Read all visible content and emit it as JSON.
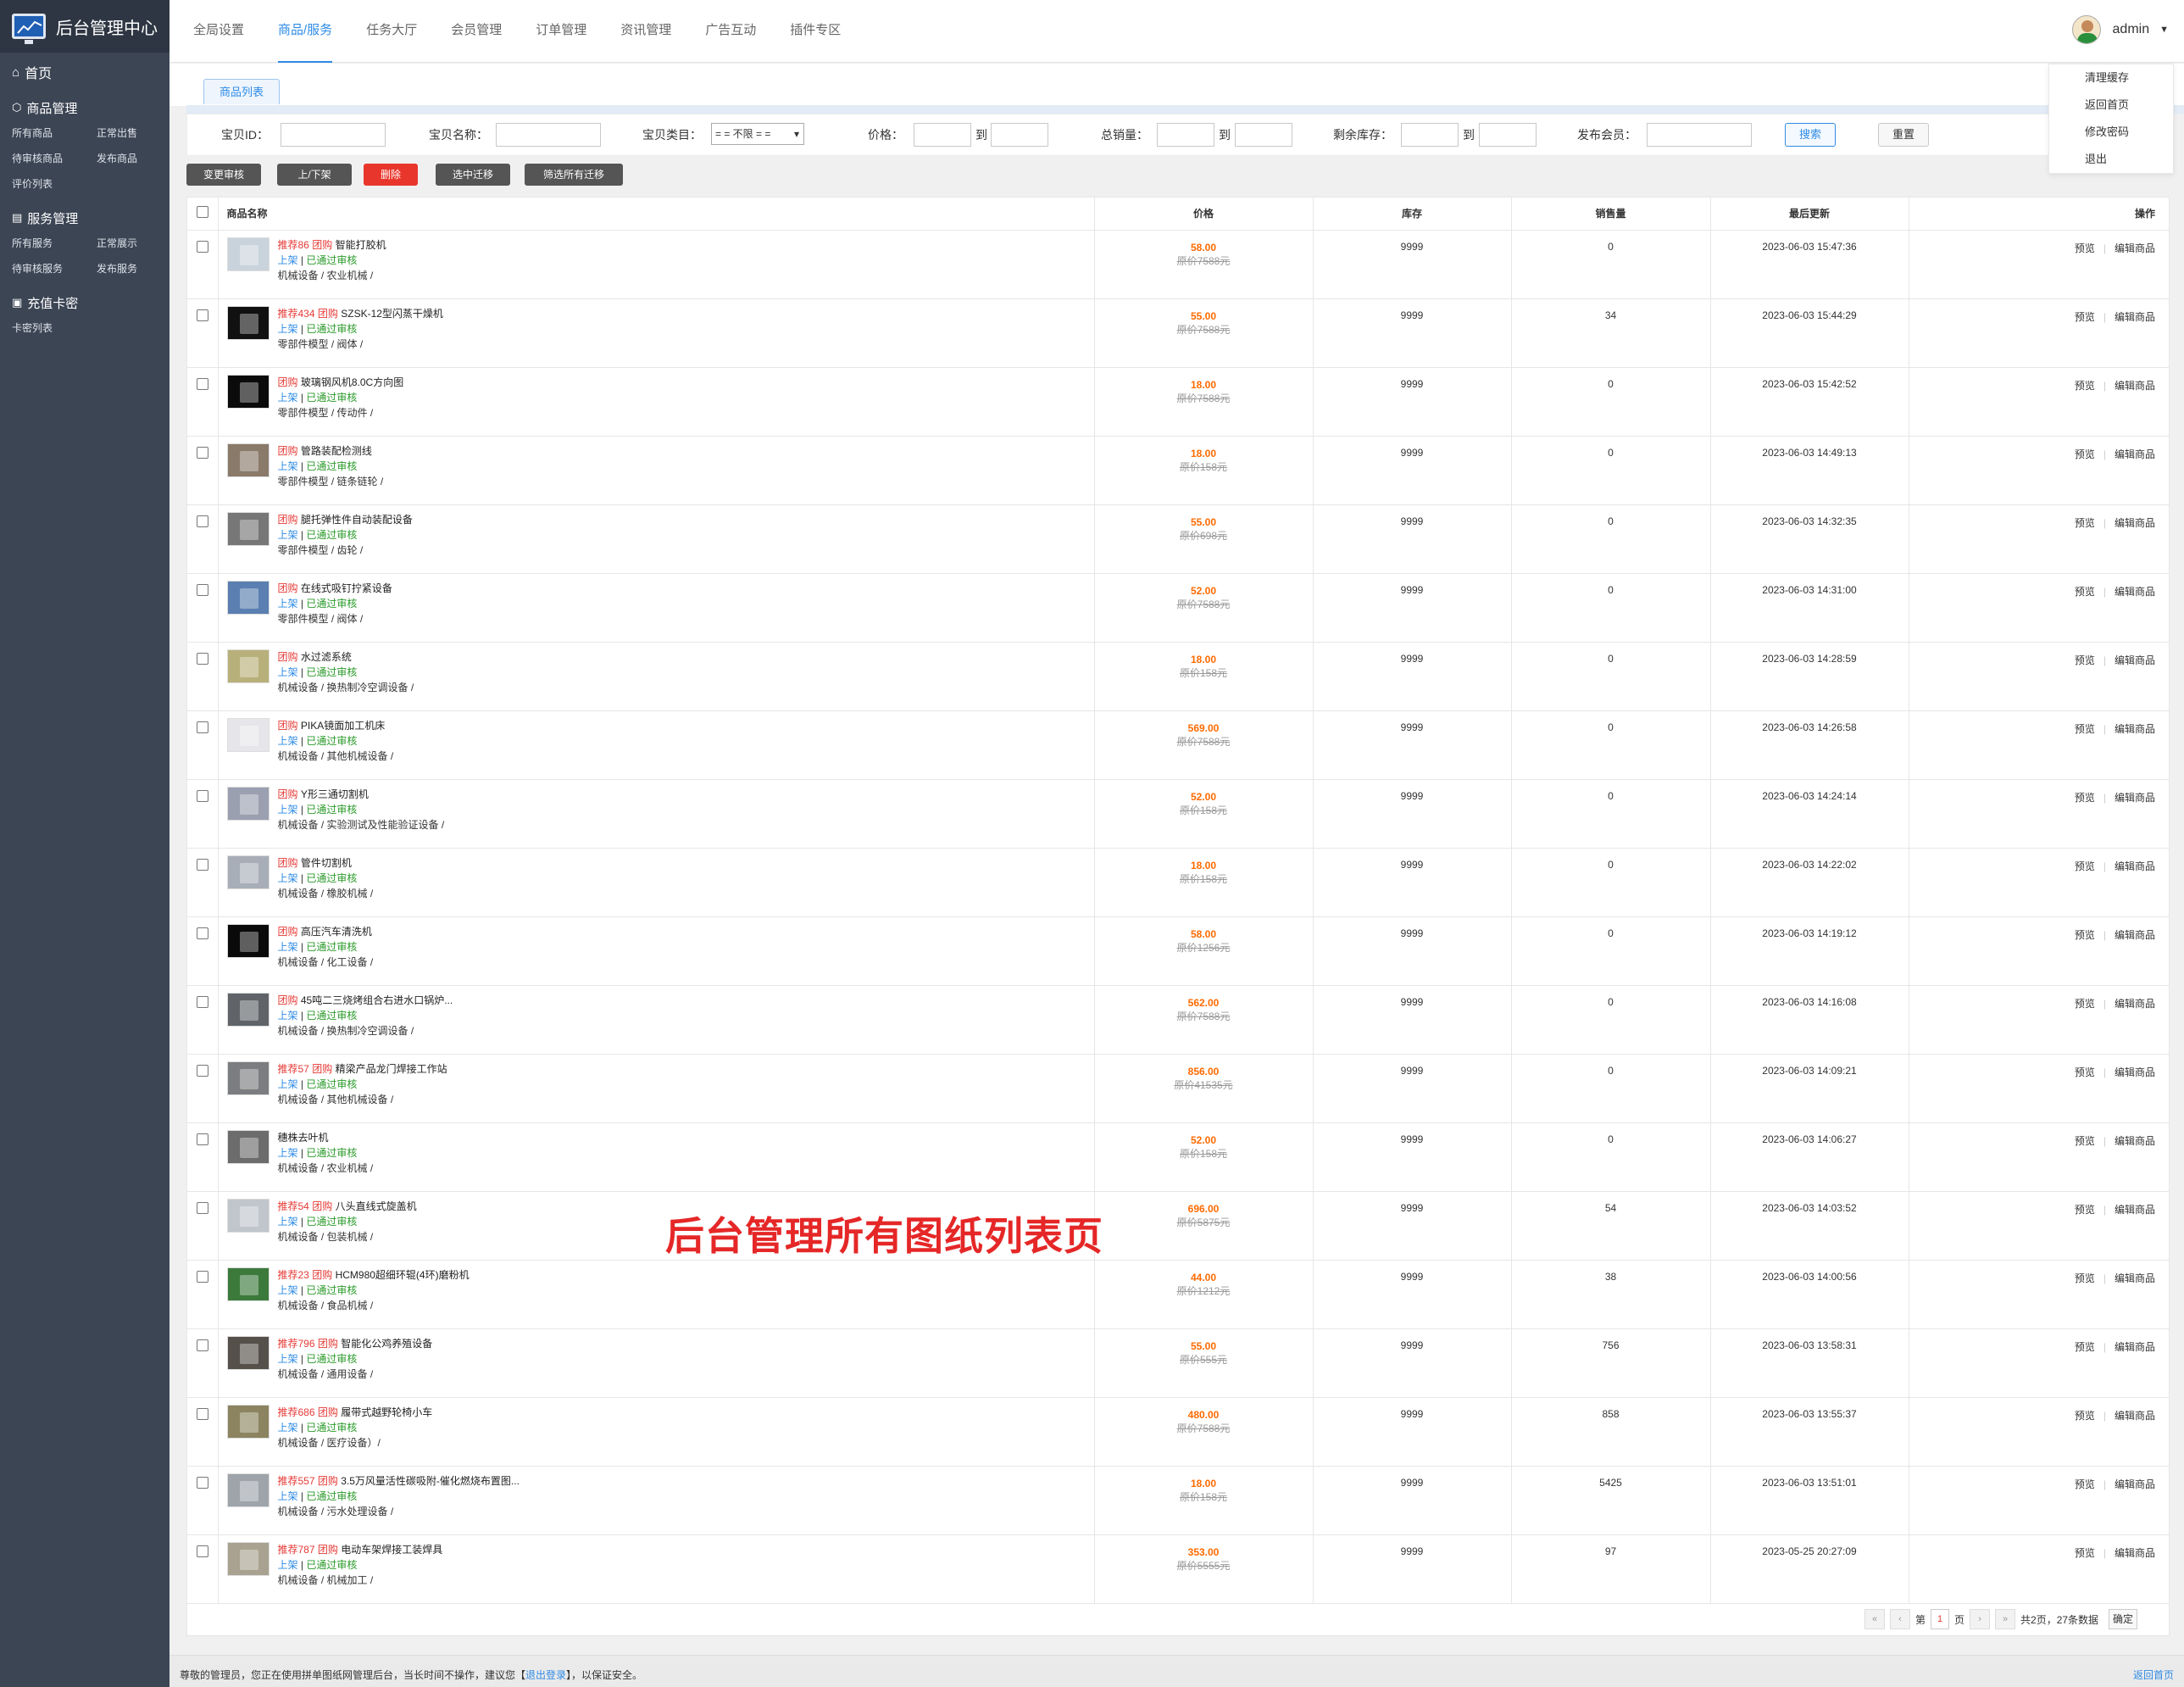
{
  "app": {
    "title": "后台管理中心"
  },
  "sidebar": {
    "home": "首页",
    "sections": [
      {
        "title": "商品管理",
        "items": [
          "所有商品",
          "正常出售",
          "待审核商品",
          "发布商品",
          "评价列表"
        ]
      },
      {
        "title": "服务管理",
        "items": [
          "所有服务",
          "正常展示",
          "待审核服务",
          "发布服务"
        ]
      },
      {
        "title": "充值卡密",
        "items": [
          "卡密列表"
        ]
      }
    ]
  },
  "topnav": [
    "全局设置",
    "商品/服务",
    "任务大厅",
    "会员管理",
    "订单管理",
    "资讯管理",
    "广告互动",
    "插件专区"
  ],
  "topnav_active": 1,
  "user": {
    "name": "admin",
    "menu": [
      "清理缓存",
      "返回首页",
      "修改密码",
      "退出"
    ]
  },
  "tab": "商品列表",
  "filter": {
    "id_label": "宝贝ID：",
    "name_label": "宝贝名称：",
    "cat_label": "宝贝类目：",
    "cat_value": "= = 不限 = =",
    "price_label": "价格：",
    "to": "到",
    "sales_label": "总销量：",
    "stock_label": "剩余库存：",
    "member_label": "发布会员：",
    "search": "搜索",
    "reset": "重置"
  },
  "actions": [
    "变更审核",
    "上/下架",
    "删除",
    "选中迁移",
    "筛选所有迁移"
  ],
  "columns": [
    "商品名称",
    "价格",
    "库存",
    "销售量",
    "最后更新",
    "操作"
  ],
  "op": {
    "preview": "预览",
    "edit": "编辑商品",
    "sep": "|"
  },
  "status": {
    "on": "上架",
    "sep": " | ",
    "ok": "已通过审核"
  },
  "rows": [
    {
      "rec": "推荐86",
      "tag": "团购",
      "name": "智能打胶机",
      "cat": "机械设备 / 农业机械 /",
      "price": "58.00",
      "orig": "原价7588元",
      "stock": "9999",
      "sales": "0",
      "time": "2023-06-03 15:47:36",
      "thumb": "#c9d3dc"
    },
    {
      "rec": "推荐434",
      "tag": "团购",
      "name": "SZSK-12型闪蒸干燥机",
      "cat": "零部件模型 / 阀体 /",
      "price": "55.00",
      "orig": "原价7588元",
      "stock": "9999",
      "sales": "34",
      "time": "2023-06-03 15:44:29",
      "thumb": "#111111"
    },
    {
      "rec": "",
      "tag": "团购",
      "name": "玻璃钢风机8.0C方向图",
      "cat": "零部件模型 / 传动件 /",
      "price": "18.00",
      "orig": "原价7588元",
      "stock": "9999",
      "sales": "0",
      "time": "2023-06-03 15:42:52",
      "thumb": "#0b0b0b"
    },
    {
      "rec": "",
      "tag": "团购",
      "name": "管路装配检测线",
      "cat": "零部件模型 / 链条链轮 /",
      "price": "18.00",
      "orig": "原价158元",
      "stock": "9999",
      "sales": "0",
      "time": "2023-06-03 14:49:13",
      "thumb": "#8a7a6a"
    },
    {
      "rec": "",
      "tag": "团购",
      "name": "腿托弹性件自动装配设备",
      "cat": "零部件模型 / 齿轮 /",
      "price": "55.00",
      "orig": "原价698元",
      "stock": "9999",
      "sales": "0",
      "time": "2023-06-03 14:32:35",
      "thumb": "#777777"
    },
    {
      "rec": "",
      "tag": "团购",
      "name": "在线式吸钉拧紧设备",
      "cat": "零部件模型 / 阀体 /",
      "price": "52.00",
      "orig": "原价7588元",
      "stock": "9999",
      "sales": "0",
      "time": "2023-06-03 14:31:00",
      "thumb": "#5a7fb0"
    },
    {
      "rec": "",
      "tag": "团购",
      "name": "水过滤系统",
      "cat": "机械设备 / 换热制冷空调设备 /",
      "price": "18.00",
      "orig": "原价158元",
      "stock": "9999",
      "sales": "0",
      "time": "2023-06-03 14:28:59",
      "thumb": "#b8b07a"
    },
    {
      "rec": "",
      "tag": "团购",
      "name": "PIKA镜面加工机床",
      "cat": "机械设备 / 其他机械设备 /",
      "price": "569.00",
      "orig": "原价7588元",
      "stock": "9999",
      "sales": "0",
      "time": "2023-06-03 14:26:58",
      "thumb": "#e6e6ea"
    },
    {
      "rec": "",
      "tag": "团购",
      "name": "Y形三通切割机",
      "cat": "机械设备 / 实验测试及性能验证设备 /",
      "price": "52.00",
      "orig": "原价158元",
      "stock": "9999",
      "sales": "0",
      "time": "2023-06-03 14:24:14",
      "thumb": "#9aa0b0"
    },
    {
      "rec": "",
      "tag": "团购",
      "name": "管件切割机",
      "cat": "机械设备 / 橡胶机械 /",
      "price": "18.00",
      "orig": "原价158元",
      "stock": "9999",
      "sales": "0",
      "time": "2023-06-03 14:22:02",
      "thumb": "#a8aeb8"
    },
    {
      "rec": "",
      "tag": "团购",
      "name": "高压汽车清洗机",
      "cat": "机械设备 / 化工设备 /",
      "price": "58.00",
      "orig": "原价1256元",
      "stock": "9999",
      "sales": "0",
      "time": "2023-06-03 14:19:12",
      "thumb": "#0a0a0a"
    },
    {
      "rec": "",
      "tag": "团购",
      "name": "45吨二三烧烤组合右进水口锅炉...",
      "cat": "机械设备 / 换热制冷空调设备 /",
      "price": "562.00",
      "orig": "原价7588元",
      "stock": "9999",
      "sales": "0",
      "time": "2023-06-03 14:16:08",
      "thumb": "#606468"
    },
    {
      "rec": "推荐57",
      "tag": "团购",
      "name": "精梁产品龙门焊接工作站",
      "cat": "机械设备 / 其他机械设备 /",
      "price": "856.00",
      "orig": "原价41535元",
      "stock": "9999",
      "sales": "0",
      "time": "2023-06-03 14:09:21",
      "thumb": "#7b7d80"
    },
    {
      "rec": "",
      "tag": "",
      "name": "穗株去叶机",
      "cat": "机械设备 / 农业机械 /",
      "price": "52.00",
      "orig": "原价158元",
      "stock": "9999",
      "sales": "0",
      "time": "2023-06-03 14:06:27",
      "thumb": "#6c6c6c"
    },
    {
      "rec": "推荐54",
      "tag": "团购",
      "name": "八头直线式旋盖机",
      "cat": "机械设备 / 包装机械 /",
      "price": "696.00",
      "orig": "原价5875元",
      "stock": "9999",
      "sales": "54",
      "time": "2023-06-03 14:03:52",
      "thumb": "#c0c6cc"
    },
    {
      "rec": "推荐23",
      "tag": "团购",
      "name": "HCM980超细环辊(4环)磨粉机",
      "cat": "机械设备 / 食品机械 /",
      "price": "44.00",
      "orig": "原价1212元",
      "stock": "9999",
      "sales": "38",
      "time": "2023-06-03 14:00:56",
      "thumb": "#3c7a3c"
    },
    {
      "rec": "推荐796",
      "tag": "团购",
      "name": "智能化公鸡养殖设备",
      "cat": "机械设备 / 通用设备 /",
      "price": "55.00",
      "orig": "原价555元",
      "stock": "9999",
      "sales": "756",
      "time": "2023-06-03 13:58:31",
      "thumb": "#55504a"
    },
    {
      "rec": "推荐686",
      "tag": "团购",
      "name": "履带式越野轮椅小车",
      "cat": "机械设备 / 医疗设备）/",
      "price": "480.00",
      "orig": "原价7588元",
      "stock": "9999",
      "sales": "858",
      "time": "2023-06-03 13:55:37",
      "thumb": "#8c8460"
    },
    {
      "rec": "推荐557",
      "tag": "团购",
      "name": "3.5万风量活性碳吸附-催化燃烧布置图...",
      "cat": "机械设备 / 污水处理设备 /",
      "price": "18.00",
      "orig": "原价158元",
      "stock": "9999",
      "sales": "5425",
      "time": "2023-06-03 13:51:01",
      "thumb": "#9ea4aa"
    },
    {
      "rec": "推荐787",
      "tag": "团购",
      "name": "电动车架焊接工装焊具",
      "cat": "机械设备 / 机械加工 /",
      "price": "353.00",
      "orig": "原价5555元",
      "stock": "9999",
      "sales": "97",
      "time": "2023-05-25 20:27:09",
      "thumb": "#a9a290"
    }
  ],
  "pager": {
    "prev_first": "«",
    "prev": "‹",
    "page_label_pre": "第",
    "page": "1",
    "page_label_post": "页",
    "next": "›",
    "next_last": "»",
    "summary": "共2页，27条数据",
    "go": "确定"
  },
  "watermark": "后台管理所有图纸列表页",
  "footer": {
    "pre": "尊敬的管理员，您正在使用拼单图纸网管理后台，当长时间不操作，建议您【",
    "link": "退出登录",
    "post": "】，以保证安全。",
    "home": "返回首页"
  }
}
